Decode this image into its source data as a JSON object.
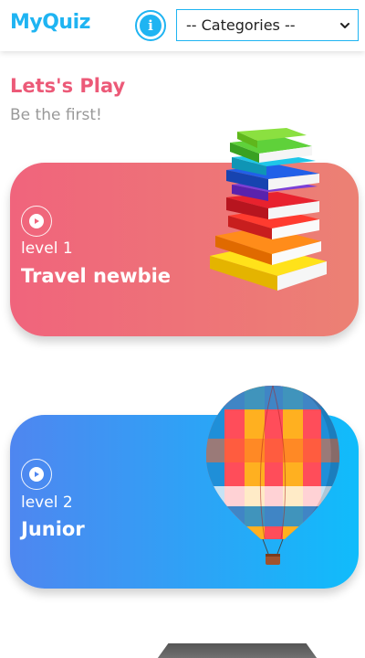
{
  "header": {
    "logo": "MyQuiz",
    "info_glyph": "i",
    "category_selected": "-- Categories --"
  },
  "intro": {
    "title": "Lets's Play",
    "subtitle": "Be the first!"
  },
  "levels": [
    {
      "level": "level 1",
      "name": "Travel newbie",
      "icon": "books-stack-icon",
      "gradient": [
        "#f0647c",
        "#ec8174"
      ]
    },
    {
      "level": "level 2",
      "name": "Junior",
      "icon": "hot-air-balloon-icon",
      "gradient": [
        "#4f86f0",
        "#10bcfb"
      ]
    }
  ],
  "colors": {
    "brand": "#1fb4f2",
    "headline": "#ec5a78",
    "muted": "#999999"
  }
}
